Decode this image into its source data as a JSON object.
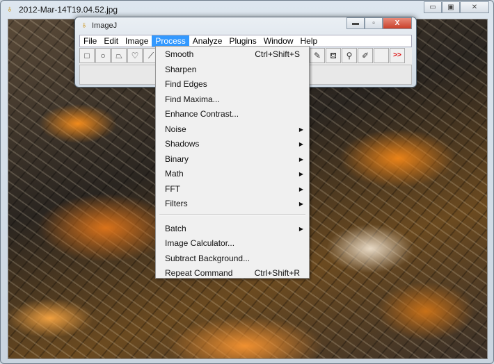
{
  "outer_window": {
    "title": "2012-Mar-14T19.04.52.jpg",
    "minimize": "▭",
    "maximize": "▣",
    "close": "✕"
  },
  "imagej": {
    "title": "ImageJ",
    "minimize": "▬",
    "maximize": "▫",
    "close": "X",
    "menus": [
      "File",
      "Edit",
      "Image",
      "Process",
      "Analyze",
      "Plugins",
      "Window",
      "Help"
    ],
    "active_menu": "Process",
    "tools_left": [
      {
        "name": "rectangle-tool",
        "glyph": "□"
      },
      {
        "name": "oval-tool",
        "glyph": "○"
      },
      {
        "name": "polygon-tool",
        "glyph": "⏢"
      },
      {
        "name": "freehand-tool",
        "glyph": "♡"
      },
      {
        "name": "line-tool",
        "glyph": "⟋"
      }
    ],
    "tools_right": [
      {
        "name": "pencil-tool",
        "glyph": "✎"
      },
      {
        "name": "flood-fill-tool",
        "glyph": "⛾"
      },
      {
        "name": "color-picker-tool",
        "glyph": "⚲"
      },
      {
        "name": "brush-tool",
        "glyph": "✐"
      },
      {
        "name": "empty-tool",
        "glyph": ""
      },
      {
        "name": "more-tools",
        "glyph": ">>"
      }
    ]
  },
  "process_menu": {
    "items": [
      {
        "label": "Smooth",
        "shortcut": "Ctrl+Shift+S"
      },
      {
        "label": "Sharpen"
      },
      {
        "label": "Find Edges"
      },
      {
        "label": "Find Maxima..."
      },
      {
        "label": "Enhance Contrast..."
      },
      {
        "label": "Noise",
        "submenu": true
      },
      {
        "label": "Shadows",
        "submenu": true
      },
      {
        "label": "Binary",
        "submenu": true
      },
      {
        "label": "Math",
        "submenu": true
      },
      {
        "label": "FFT",
        "submenu": true
      },
      {
        "label": "Filters",
        "submenu": true
      },
      {
        "label": "Batch",
        "submenu": true
      },
      {
        "label": "Image Calculator..."
      },
      {
        "label": "Subtract Background..."
      },
      {
        "label": "Repeat Command",
        "shortcut": "Ctrl+Shift+R"
      }
    ],
    "submenu_arrow": "▶"
  },
  "colors": {
    "menu_highlight": "#3399ff"
  }
}
